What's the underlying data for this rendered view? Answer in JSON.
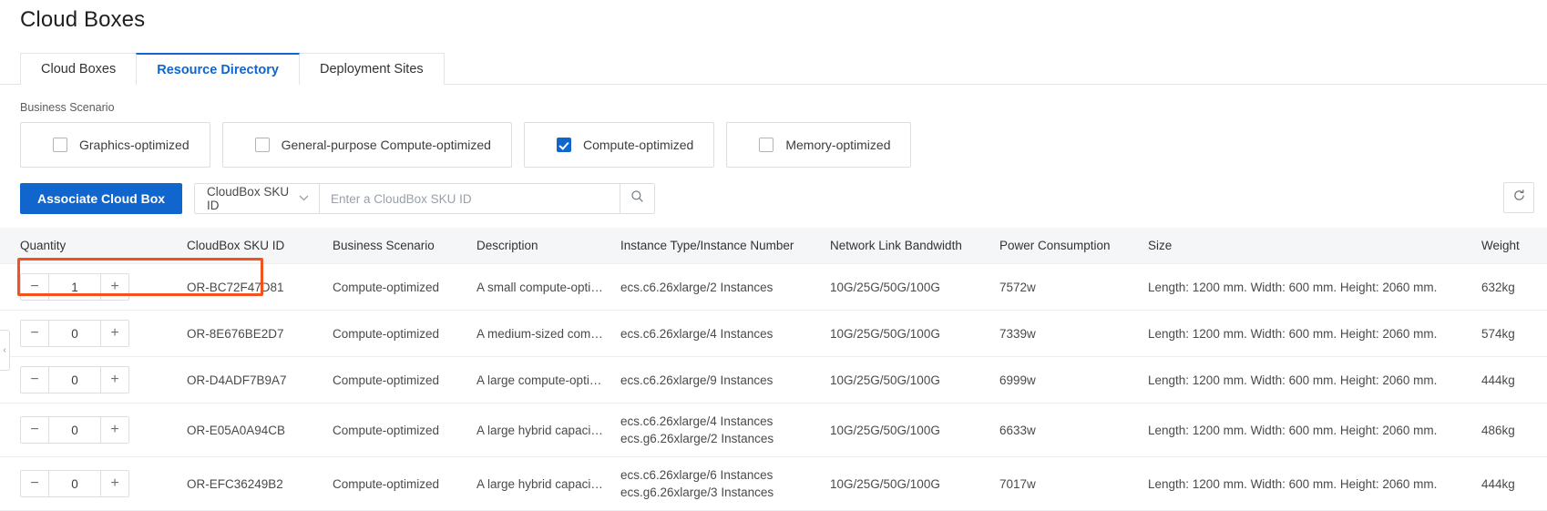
{
  "page": {
    "title": "Cloud Boxes"
  },
  "tabs": [
    {
      "label": "Cloud Boxes",
      "active": false
    },
    {
      "label": "Resource Directory",
      "active": true
    },
    {
      "label": "Deployment Sites",
      "active": false
    }
  ],
  "filter": {
    "label": "Business Scenario",
    "options": [
      {
        "label": "Graphics-optimized",
        "checked": false
      },
      {
        "label": "General-purpose Compute-optimized",
        "checked": false
      },
      {
        "label": "Compute-optimized",
        "checked": true
      },
      {
        "label": "Memory-optimized",
        "checked": false
      }
    ]
  },
  "toolbar": {
    "associate_button": "Associate Cloud Box",
    "select_value": "CloudBox SKU ID",
    "search_placeholder": "Enter a CloudBox SKU ID",
    "search_value": "",
    "search_icon": "search-icon",
    "refresh_icon": "refresh-icon",
    "dropdown_icon": "chevron-down-icon"
  },
  "table": {
    "columns": [
      "Quantity",
      "CloudBox SKU ID",
      "Business Scenario",
      "Description",
      "Instance Type/Instance Number",
      "Network Link Bandwidth",
      "Power Consumption",
      "Size",
      "Weight"
    ],
    "rows": [
      {
        "quantity": "1",
        "sku": "OR-BC72F47D81",
        "scenario": "Compute-optimized",
        "description": "A small compute-optimiz...",
        "instances": [
          "ecs.c6.26xlarge/2 Instances"
        ],
        "bandwidth": "10G/25G/50G/100G",
        "power": "7572w",
        "size": "Length: 1200 mm. Width: 600 mm. Height: 2060 mm.",
        "weight": "632kg",
        "highlighted": true
      },
      {
        "quantity": "0",
        "sku": "OR-8E676BE2D7",
        "scenario": "Compute-optimized",
        "description": "A medium-sized comput...",
        "instances": [
          "ecs.c6.26xlarge/4 Instances"
        ],
        "bandwidth": "10G/25G/50G/100G",
        "power": "7339w",
        "size": "Length: 1200 mm. Width: 600 mm. Height: 2060 mm.",
        "weight": "574kg",
        "highlighted": false
      },
      {
        "quantity": "0",
        "sku": "OR-D4ADF7B9A7",
        "scenario": "Compute-optimized",
        "description": "A large compute-optimiz...",
        "instances": [
          "ecs.c6.26xlarge/9 Instances"
        ],
        "bandwidth": "10G/25G/50G/100G",
        "power": "6999w",
        "size": "Length: 1200 mm. Width: 600 mm. Height: 2060 mm.",
        "weight": "444kg",
        "highlighted": false
      },
      {
        "quantity": "0",
        "sku": "OR-E05A0A94CB",
        "scenario": "Compute-optimized",
        "description": "A large hybrid capacity, c...",
        "instances": [
          "ecs.c6.26xlarge/4 Instances",
          "ecs.g6.26xlarge/2 Instances"
        ],
        "bandwidth": "10G/25G/50G/100G",
        "power": "6633w",
        "size": "Length: 1200 mm. Width: 600 mm. Height: 2060 mm.",
        "weight": "486kg",
        "highlighted": false
      },
      {
        "quantity": "0",
        "sku": "OR-EFC36249B2",
        "scenario": "Compute-optimized",
        "description": "A large hybrid capacity, c...",
        "instances": [
          "ecs.c6.26xlarge/6 Instances",
          "ecs.g6.26xlarge/3 Instances"
        ],
        "bandwidth": "10G/25G/50G/100G",
        "power": "7017w",
        "size": "Length: 1200 mm. Width: 600 mm. Height: 2060 mm.",
        "weight": "444kg",
        "highlighted": false
      }
    ],
    "stepper": {
      "minus": "−",
      "plus": "+"
    }
  },
  "collapse_handle": {
    "icon": "chevron-left-icon",
    "glyph": "‹"
  },
  "colors": {
    "accent_blue": "#1066cc",
    "highlight_orange": "#f4511e",
    "header_bg": "#f4f6f8",
    "border": "#dcdee1"
  }
}
